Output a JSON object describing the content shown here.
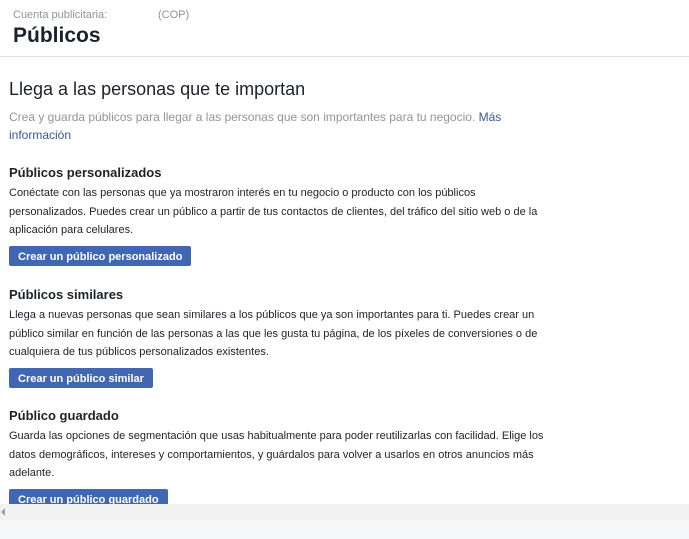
{
  "header": {
    "account_label": "Cuenta publicitaria:",
    "account_currency": "(COP)",
    "title": "Públicos"
  },
  "hero": {
    "title": "Llega a las personas que te importan",
    "description": "Crea y guarda públicos para llegar a las personas que son importantes para tu negocio.",
    "link_label": "Más información"
  },
  "sections": [
    {
      "title": "Públicos personalizados",
      "description": "Conéctate con las personas que ya mostraron interés en tu negocio o producto con los públicos personalizados. Puedes crear un público a partir de tus contactos de clientes, del tráfico del sitio web o de la aplicación para celulares.",
      "button_label": "Crear un público personalizado"
    },
    {
      "title": "Públicos similares",
      "description": "Llega a nuevas personas que sean similares a los públicos que ya son importantes para ti. Puedes crear un público similar en función de las personas a las que les gusta tu página, de los píxeles de conversiones o de cualquiera de tus públicos personalizados existentes.",
      "button_label": "Crear un público similar"
    },
    {
      "title": "Público guardado",
      "description": "Guarda las opciones de segmentación que usas habitualmente para poder reutilizarlas con facilidad. Elige los datos demográficos, intereses y comportamientos, y guárdalos para volver a usarlos en otros anuncios más adelante.",
      "button_label": "Crear un público guardado"
    }
  ],
  "colors": {
    "button_bg": "#4267b2",
    "link": "#365899",
    "muted_text": "#90949c"
  }
}
